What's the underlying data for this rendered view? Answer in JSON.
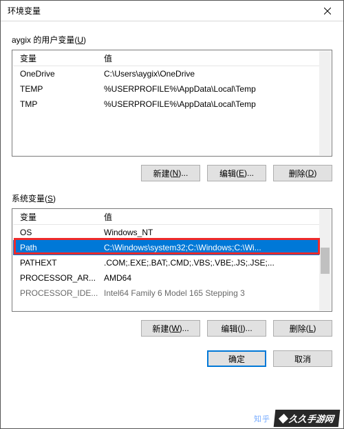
{
  "window": {
    "title": "环境变量"
  },
  "user_section": {
    "label_plain": "aygix 的用户变量",
    "label_hotkey": "U",
    "header_var": "变量",
    "header_val": "值",
    "rows": [
      {
        "var": "OneDrive",
        "val": "C:\\Users\\aygix\\OneDrive"
      },
      {
        "var": "TEMP",
        "val": "%USERPROFILE%\\AppData\\Local\\Temp"
      },
      {
        "var": "TMP",
        "val": "%USERPROFILE%\\AppData\\Local\\Temp"
      }
    ],
    "buttons": {
      "new": {
        "text": "新建",
        "hotkey": "N"
      },
      "edit": {
        "text": "编辑",
        "hotkey": "E"
      },
      "delete": {
        "text": "删除",
        "hotkey": "D"
      }
    }
  },
  "system_section": {
    "label_plain": "系统变量",
    "label_hotkey": "S",
    "header_var": "变量",
    "header_val": "值",
    "rows": [
      {
        "var": "OS",
        "val": "Windows_NT"
      },
      {
        "var": "Path",
        "val": "C:\\Windows\\system32;C:\\Windows;C:\\Wi...",
        "selected": true
      },
      {
        "var": "PATHEXT",
        "val": ".COM;.EXE;.BAT;.CMD;.VBS;.VBE;.JS;.JSE;..."
      },
      {
        "var": "PROCESSOR_AR...",
        "val": "AMD64"
      },
      {
        "var": "PROCESSOR_IDE...",
        "val": "Intel64 Family 6 Model 165 Stepping 3"
      }
    ],
    "buttons": {
      "new": {
        "text": "新建",
        "hotkey": "W"
      },
      "edit": {
        "text": "编辑",
        "hotkey": "I"
      },
      "delete": {
        "text": "删除",
        "hotkey": "L"
      }
    }
  },
  "footer": {
    "ok": "确定",
    "cancel": "取消"
  },
  "watermark": {
    "left": "知乎",
    "right": "久久手游网"
  }
}
